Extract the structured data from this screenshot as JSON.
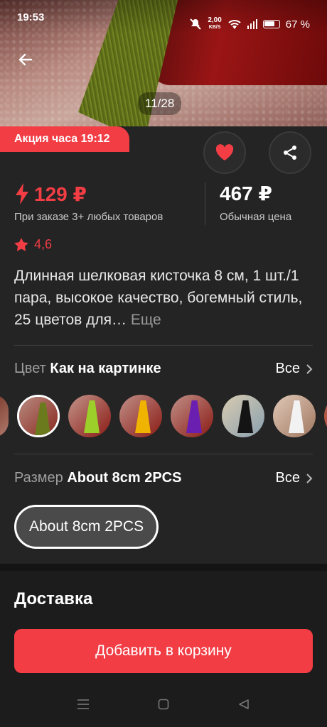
{
  "status_bar": {
    "time": "19:53",
    "net_speed_value": "2,00",
    "net_speed_unit": "KB/S",
    "battery": "67 %"
  },
  "gallery": {
    "pager": "11/28"
  },
  "promo": {
    "label": "Акция часа 19:12"
  },
  "price": {
    "sale_price": "129 ₽",
    "sale_note": "При заказе 3+ любых товаров",
    "regular_price": "467 ₽",
    "regular_note": "Обычная цена"
  },
  "rating": {
    "value": "4,6"
  },
  "product": {
    "title": "Длинная шелковая кисточка 8 см, 1 шт./1 пара, высокое качество, богемный стиль, 25 цветов для…",
    "more_label": "Еще"
  },
  "color_option": {
    "label": "Цвет",
    "value": "Как на картинке",
    "all_label": "Все",
    "swatches": [
      {
        "name": "partial",
        "color": "#8c3b2a"
      },
      {
        "name": "olive",
        "color": "#6b7a1c"
      },
      {
        "name": "light-green",
        "color": "#9ccf2a"
      },
      {
        "name": "yellow",
        "color": "#f0b400"
      },
      {
        "name": "purple",
        "color": "#6a1fb0"
      },
      {
        "name": "black",
        "color": "#141414"
      },
      {
        "name": "white",
        "color": "#f2f2f2"
      },
      {
        "name": "partial-right",
        "color": "#c0392b"
      }
    ]
  },
  "size_option": {
    "label": "Размер",
    "value": "About 8cm 2PCS",
    "all_label": "Все",
    "chip": "About 8cm 2PCS"
  },
  "delivery": {
    "title": "Доставка"
  },
  "cart": {
    "button": "Добавить в корзину"
  },
  "colors": {
    "accent": "#f23d45",
    "background": "#242424"
  }
}
